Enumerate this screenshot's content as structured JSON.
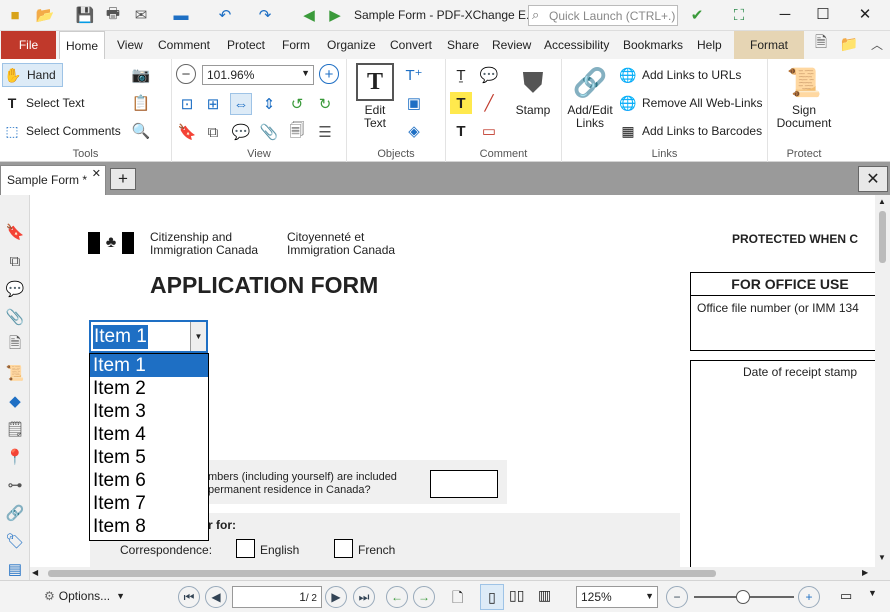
{
  "window": {
    "title": "Sample Form - PDF-XChange E..",
    "quick_launch_placeholder": "Quick Launch (CTRL+.)"
  },
  "menu": {
    "file": "File",
    "tabs": [
      "Home",
      "View",
      "Comment",
      "Protect",
      "Form",
      "Organize",
      "Convert",
      "Share",
      "Review",
      "Accessibility",
      "Bookmarks",
      "Help",
      "Format"
    ]
  },
  "ribbon": {
    "tools": {
      "label": "Tools",
      "hand": "Hand",
      "select_text": "Select Text",
      "select_comments": "Select Comments"
    },
    "view": {
      "label": "View",
      "zoom": "101.96%"
    },
    "objects": {
      "label": "Objects",
      "edit_text": "Edit Text"
    },
    "comment": {
      "label": "Comment",
      "stamp": "Stamp"
    },
    "links": {
      "label": "Links",
      "add_edit": "Add/Edit Links",
      "add_links_urls": "Add Links to URLs",
      "remove_links": "Remove All Web-Links",
      "add_links_barcodes": "Add Links to Barcodes"
    },
    "protect": {
      "label": "Protect",
      "sign": "Sign Document"
    }
  },
  "document": {
    "tab_title": "Sample Form *",
    "dept_en": "Citizenship and Immigration Canada",
    "dept_fr": "Citoyenneté et Immigration Canada",
    "form_title": "APPLICATION FORM",
    "protected": "PROTECTED WHEN C",
    "office_use": "FOR OFFICE USE",
    "office_file": "Office file number (or IMM 134",
    "receipt": "Date of receipt stamp",
    "members_q1": "mbers (including yourself) are included",
    "members_q2": "permanent residence in Canada?",
    "r_for": "r for:",
    "correspondence": "Correspondence:",
    "english": "English",
    "french": "French"
  },
  "dropdown": {
    "value": "Item 1",
    "options": [
      "Item 1",
      "Item 2",
      "Item 3",
      "Item 4",
      "Item 5",
      "Item 6",
      "Item 7",
      "Item 8"
    ],
    "selected_index": 0
  },
  "status": {
    "options": "Options...",
    "page": "1",
    "page_total": "/ 2",
    "zoom": "125%"
  },
  "colors": {
    "accent": "#1e6fc4",
    "file_tab": "#c0392b"
  }
}
